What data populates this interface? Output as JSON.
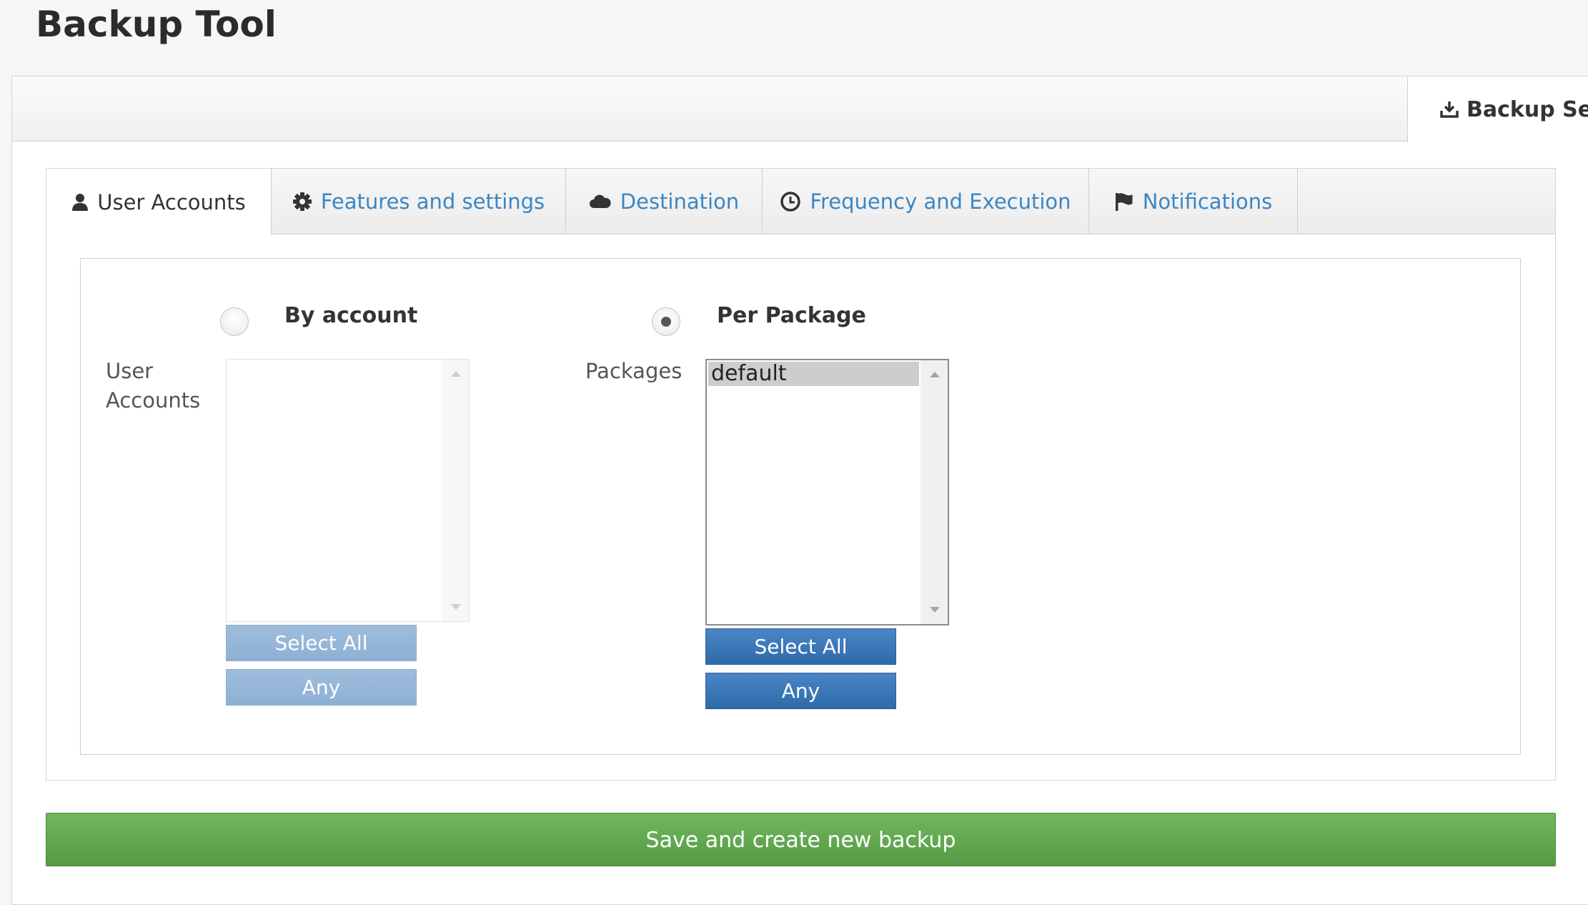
{
  "page": {
    "title": "Backup Tool"
  },
  "panel": {
    "tab_label": "Backup Sett",
    "tab_icon": "download-icon"
  },
  "tabs": [
    {
      "label": "User Accounts",
      "icon": "user-icon",
      "active": true
    },
    {
      "label": "Features and settings",
      "icon": "gear-icon",
      "active": false
    },
    {
      "label": "Destination",
      "icon": "cloud-icon",
      "active": false
    },
    {
      "label": "Frequency and Execution",
      "icon": "clock-icon",
      "active": false
    },
    {
      "label": "Notifications",
      "icon": "flag-icon",
      "active": false
    }
  ],
  "mode": {
    "by_account": {
      "label": "By account",
      "selected": false
    },
    "per_package": {
      "label": "Per Package",
      "selected": true
    }
  },
  "user_accounts": {
    "label": "User Accounts",
    "label_line1": "User",
    "label_line2": "Accounts",
    "options": [],
    "select_all_label": "Select All",
    "any_label": "Any",
    "disabled": true
  },
  "packages": {
    "label": "Packages",
    "options": [
      {
        "label": "default",
        "selected": true
      }
    ],
    "select_all_label": "Select All",
    "any_label": "Any",
    "disabled": false
  },
  "save_button": {
    "label": "Save and create new backup"
  },
  "colors": {
    "link_blue": "#3b86c4",
    "button_blue": "#3a78b8",
    "button_blue_disabled": "#97b7d8",
    "save_green": "#62a84f"
  }
}
